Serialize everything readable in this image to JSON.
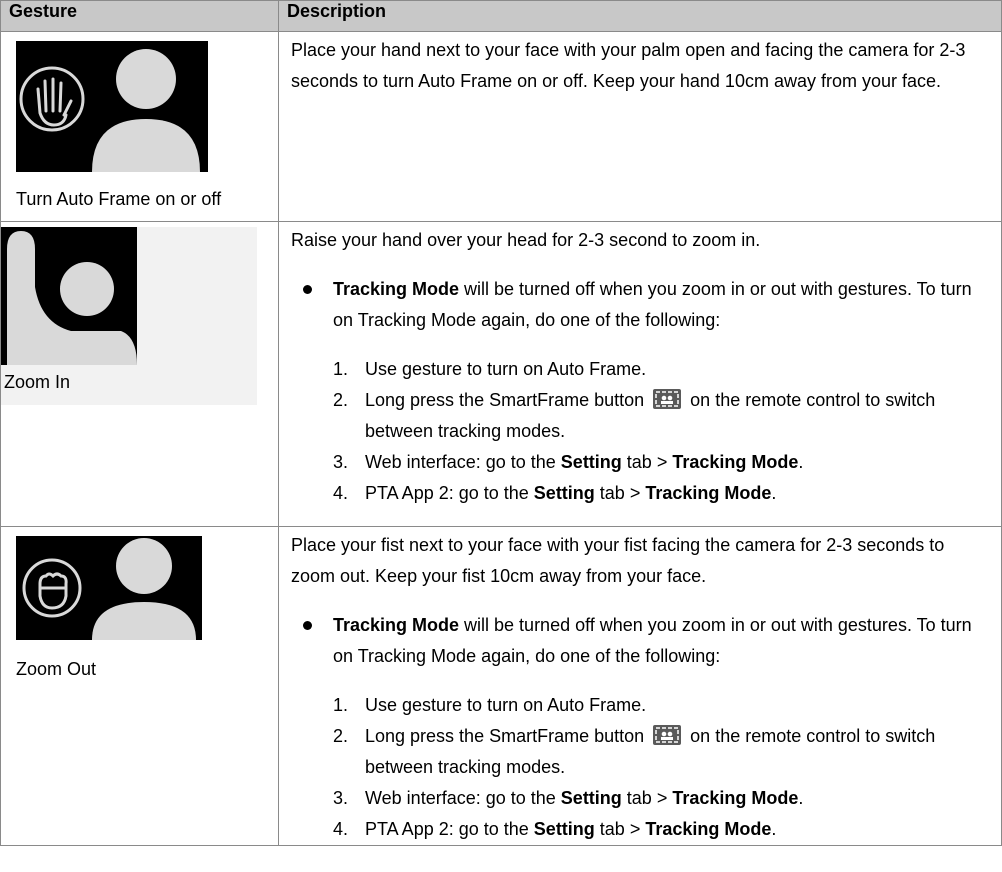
{
  "header": {
    "gesture": "Gesture",
    "description": "Description"
  },
  "rows": [
    {
      "label": "Turn Auto Frame on or off",
      "desc": "Place your hand next to your face with your palm open and facing the camera for 2-3 seconds to turn Auto Frame on or off. Keep your hand 10cm away from your face."
    },
    {
      "label": "Zoom In",
      "desc": "Raise your hand over your head for 2-3 second to zoom in."
    },
    {
      "label": "Zoom Out",
      "desc": "Place your fist next to your face with your fist facing the camera for 2-3 seconds to zoom out. Keep your fist 10cm away from your face."
    }
  ],
  "note": {
    "bold": "Tracking Mode",
    "text": " will be turned off when you zoom in or out with gestures. To turn on Tracking Mode again, do one of the following:"
  },
  "steps": {
    "n1": "1.",
    "s1": "Use gesture to turn on Auto Frame.",
    "n2": "2.",
    "s2a": "Long press the SmartFrame button",
    "s2b": "on the remote control to switch between tracking modes.",
    "n3": "3.",
    "s3a": "Web interface: go to the ",
    "setting": "Setting",
    "tab": " tab > ",
    "tracking": "Tracking Mode",
    "dot": ".",
    "n4": "4.",
    "s4a": "PTA App 2: go to the "
  },
  "colors": {
    "header_bg": "#c8c8c8",
    "image_bg": "#000000",
    "figure": "#d9d9d9"
  }
}
